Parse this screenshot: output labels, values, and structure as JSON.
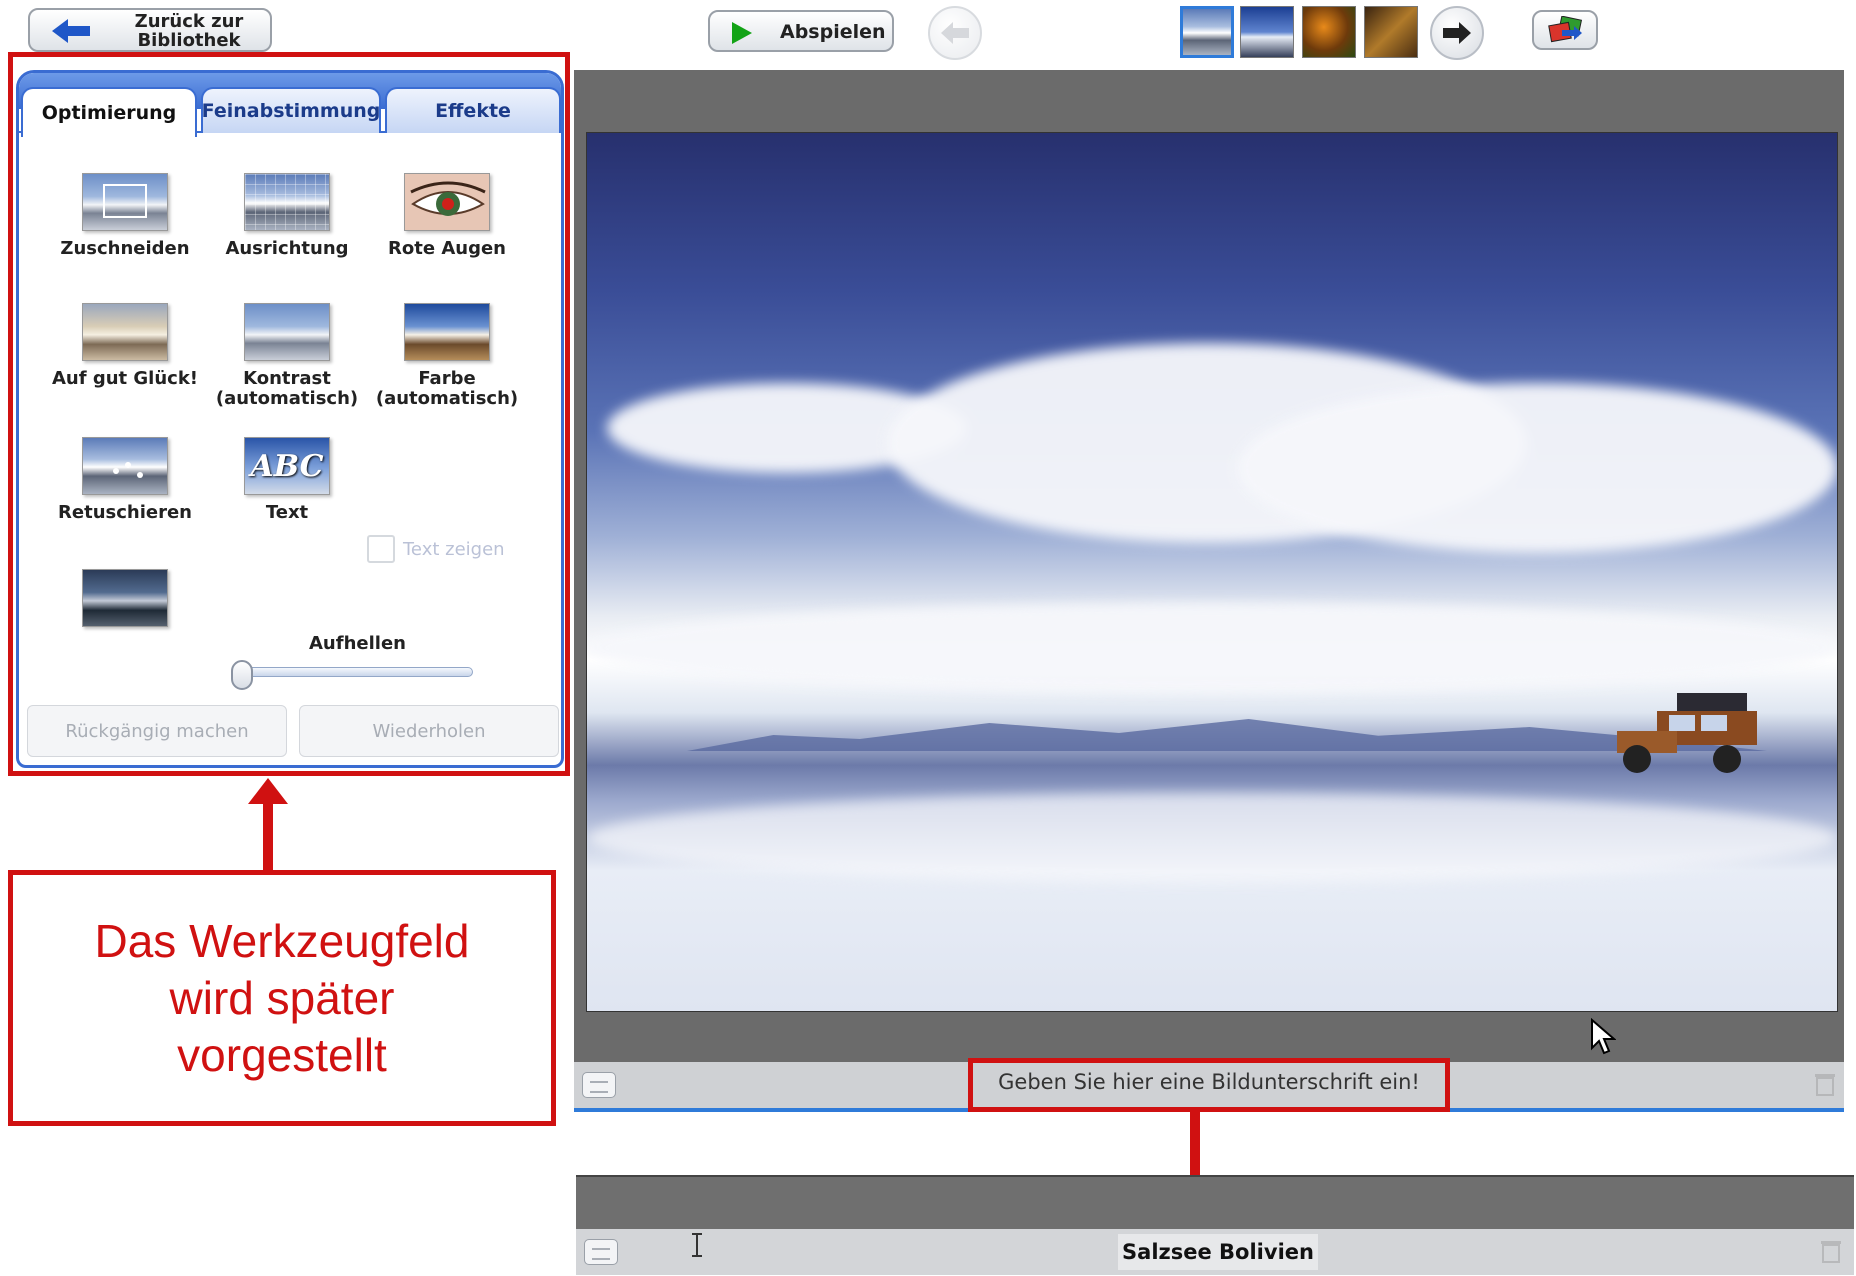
{
  "toolbar": {
    "back_label_line1": "Zurück zur",
    "back_label_line2": "Bibliothek",
    "play_label": "Abspielen"
  },
  "panel": {
    "tabs": [
      "Optimierung",
      "Feinabstimmung",
      "Effekte"
    ],
    "active_tab": "Optimierung",
    "tools": [
      {
        "label": "Zuschneiden",
        "icon": "crop-icon"
      },
      {
        "label": "Ausrichtung",
        "icon": "straighten-icon"
      },
      {
        "label": "Rote Augen",
        "icon": "red-eye-icon"
      },
      {
        "label": "Auf gut Glück!",
        "icon": "auto-enhance-icon"
      },
      {
        "label_line1": "Kontrast",
        "label_line2": "(automatisch)",
        "icon": "auto-contrast-icon"
      },
      {
        "label_line1": "Farbe",
        "label_line2": "(automatisch)",
        "icon": "auto-color-icon"
      },
      {
        "label": "Retuschieren",
        "icon": "retouch-icon"
      },
      {
        "label": "Text",
        "icon": "text-icon",
        "icon_text": "ABC"
      }
    ],
    "show_text_checkbox_label": "Text zeigen",
    "show_text_checked": false,
    "brighten_label": "Aufhellen",
    "brighten_value": 0,
    "undo_label": "Rückgängig machen",
    "redo_label": "Wiederholen"
  },
  "photo": {
    "caption_placeholder": "Geben Sie hier eine Bildunterschrift ein!"
  },
  "annotation": {
    "callout_text": "Das Werkzeugfeld wird später vorgestellt"
  },
  "inset": {
    "caption_value": "Salzsee Bolivien"
  },
  "colors": {
    "accent_blue": "#3a6cd2",
    "annotation_red": "#d01111",
    "play_green": "#13a316"
  }
}
